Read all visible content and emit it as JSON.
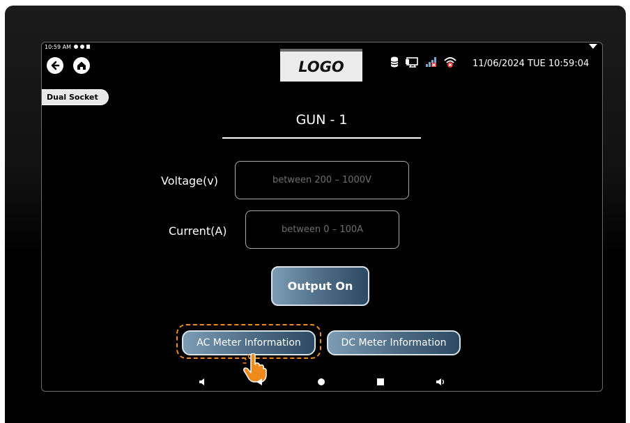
{
  "status_bar": {
    "time": "10:59 AM"
  },
  "header": {
    "logo_text": "LOGO",
    "datetime": "11/06/2024 TUE 10:59:04",
    "icons": [
      "back-icon",
      "home-icon",
      "database-icon",
      "network-icon",
      "signal-icon",
      "wifi-error-icon"
    ]
  },
  "socket_tab": "Dual Socket",
  "gun": {
    "title": "GUN - 1"
  },
  "form": {
    "voltage_label": "Voltage(v)",
    "voltage_placeholder": "between 200 – 1000V",
    "current_label": "Current(A)",
    "current_placeholder": "between 0 – 100A"
  },
  "buttons": {
    "output": "Output On",
    "ac_meter": "AC Meter Information",
    "dc_meter": "DC Meter Information"
  },
  "colors": {
    "accent_start": "#7c9cb5",
    "accent_end": "#2b4a63",
    "highlight": "#f08a1c"
  }
}
